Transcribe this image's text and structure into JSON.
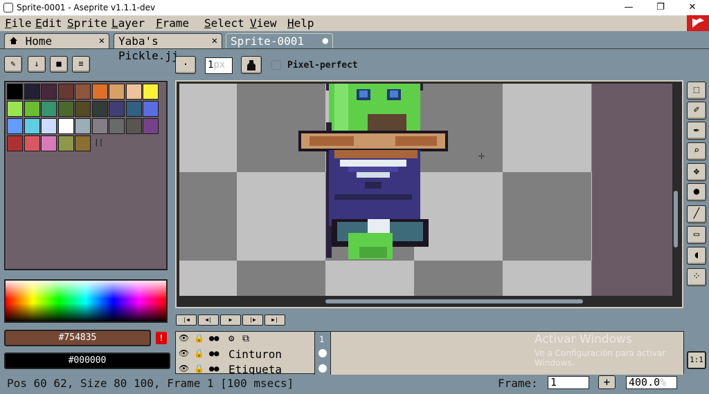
{
  "window": {
    "title": "Sprite-0001 - Aseprite v1.1.1-dev",
    "minimize": "—",
    "maximize": "❐",
    "close": "✕"
  },
  "menu": [
    "File",
    "Edit",
    "Sprite",
    "Layer",
    "Frame",
    "Select",
    "View",
    "Help"
  ],
  "tabs": [
    {
      "label": "Home",
      "close": "✕",
      "icon": "home-icon"
    },
    {
      "label": "Yaba's Pickle.jj",
      "close": "✕"
    },
    {
      "label": "Sprite-0001",
      "close": "●"
    }
  ],
  "palette_toolbar": {
    "icons": [
      "pencil-icon",
      "arrow-down-icon",
      "folder-icon",
      "menu-icon"
    ]
  },
  "palette": [
    "#000000",
    "#222034",
    "#45283c",
    "#663931",
    "#8f563b",
    "#df7126",
    "#d9a066",
    "#eec39a",
    "#fbf236",
    "#99e550",
    "#6abe30",
    "#37946e",
    "#4b692f",
    "#524b24",
    "#323c39",
    "#3f3f74",
    "#306082",
    "#5b6ee1",
    "#639bff",
    "#5fcde4",
    "#cbdbfc",
    "#ffffff",
    "#9badb7",
    "#847e87",
    "#696a6a",
    "#595652",
    "#76428a",
    "#ac3232",
    "#d95763",
    "#d77bba",
    "#8f974a",
    "#8a6f30"
  ],
  "fg_color": {
    "label": "#754835",
    "hex": "#754835"
  },
  "bg_color": {
    "label": "#000000",
    "hex": "#000000"
  },
  "warning_icon": "!",
  "context_bar": {
    "brush_type": "·",
    "brush_size": "1",
    "brush_unit": "px",
    "pixel_perfect_label": "Pixel-perfect"
  },
  "tools": [
    "marquee-icon",
    "eraser-icon",
    "eyedropper-icon",
    "zoom-icon",
    "move-icon",
    "bucket-icon",
    "line-icon",
    "rectangle-icon",
    "blur-icon",
    "spray-icon"
  ],
  "animation_controls": [
    "first-frame-icon",
    "previous-frame-icon",
    "play-icon",
    "next-frame-icon",
    "last-frame-icon"
  ],
  "timeline": {
    "layers": [
      {
        "name": "Cinturon"
      },
      {
        "name": "Etiqueta"
      }
    ],
    "frame_number": "1"
  },
  "watermark": {
    "line1": "Activar Windows",
    "line2": "Ve a Configuración para activar",
    "line3": "Windows."
  },
  "onebyone": "1:1",
  "status": {
    "text": "Pos 60 62, Size 80 100, Frame 1 [100 msecs]",
    "frame_label": "Frame:",
    "frame_value": "1",
    "add_frame": "+",
    "zoom": "400.0",
    "zoom_unit": "%"
  }
}
